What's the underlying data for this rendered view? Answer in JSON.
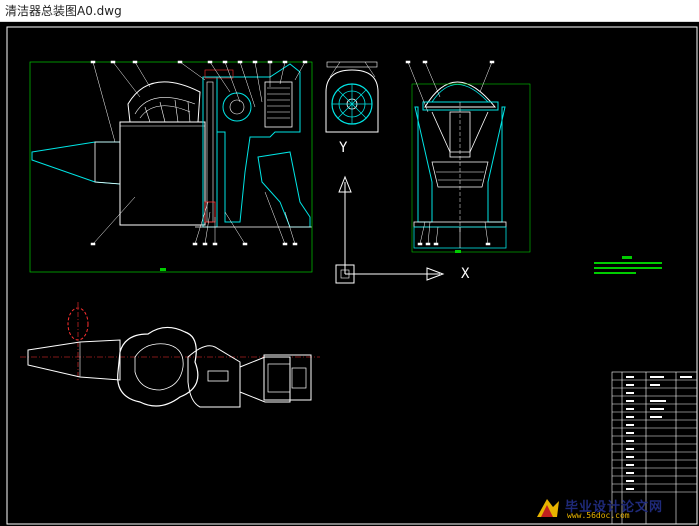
{
  "window": {
    "title": "清洁器总装图A0.dwg"
  },
  "colors": {
    "background": "#000000",
    "line_white": "#ffffff",
    "line_cyan": "#00e5e5",
    "line_green": "#00cc00",
    "line_yellow": "#e8e800"
  },
  "axis": {
    "x_label": "X",
    "y_label": "Y"
  },
  "watermark": {
    "text": "毕业设计论文网",
    "url": "www.56doc.com"
  }
}
